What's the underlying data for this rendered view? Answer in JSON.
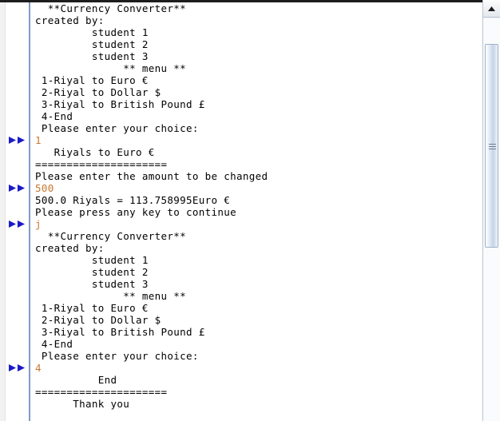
{
  "window": {
    "kind": "ide-console-output",
    "title": "Output"
  },
  "colors": {
    "output_text": "#000000",
    "input_text": "#c8762e",
    "gutter_rule": "#7e9bc4",
    "marker": "#1a1ac8",
    "scrollbar_thumb": "#c5d3e6",
    "background": "#ffffff"
  },
  "console": {
    "gutter": {
      "marker_icon": "double-right-triangle-icon",
      "marker_title": "user input line"
    },
    "lines": [
      {
        "id": 1,
        "text": "  **Currency Converter**",
        "kind": "output"
      },
      {
        "id": 2,
        "text": "created by:",
        "kind": "output"
      },
      {
        "id": 3,
        "text": "         student 1",
        "kind": "output"
      },
      {
        "id": 4,
        "text": "         student 2",
        "kind": "output"
      },
      {
        "id": 5,
        "text": "         student 3",
        "kind": "output"
      },
      {
        "id": 6,
        "text": "              ** menu **",
        "kind": "output"
      },
      {
        "id": 7,
        "text": " 1-Riyal to Euro €",
        "kind": "output"
      },
      {
        "id": 8,
        "text": " 2-Riyal to Dollar $",
        "kind": "output"
      },
      {
        "id": 9,
        "text": " 3-Riyal to British Pound £",
        "kind": "output"
      },
      {
        "id": 10,
        "text": " 4-End",
        "kind": "output"
      },
      {
        "id": 11,
        "text": " Please enter your choice:",
        "kind": "output"
      },
      {
        "id": 12,
        "text": "1",
        "kind": "input"
      },
      {
        "id": 13,
        "text": "   Riyals to Euro €",
        "kind": "output"
      },
      {
        "id": 14,
        "text": "=====================",
        "kind": "output"
      },
      {
        "id": 15,
        "text": "Please enter the amount to be changed",
        "kind": "output"
      },
      {
        "id": 16,
        "text": "500",
        "kind": "input"
      },
      {
        "id": 17,
        "text": "500.0 Riyals = 113.758995Euro €",
        "kind": "output"
      },
      {
        "id": 18,
        "text": "Please press any key to continue",
        "kind": "output"
      },
      {
        "id": 19,
        "text": "j",
        "kind": "input"
      },
      {
        "id": 20,
        "text": "  **Currency Converter**",
        "kind": "output"
      },
      {
        "id": 21,
        "text": "created by:",
        "kind": "output"
      },
      {
        "id": 22,
        "text": "         student 1",
        "kind": "output"
      },
      {
        "id": 23,
        "text": "         student 2",
        "kind": "output"
      },
      {
        "id": 24,
        "text": "         student 3",
        "kind": "output"
      },
      {
        "id": 25,
        "text": "              ** menu **",
        "kind": "output"
      },
      {
        "id": 26,
        "text": " 1-Riyal to Euro €",
        "kind": "output"
      },
      {
        "id": 27,
        "text": " 2-Riyal to Dollar $",
        "kind": "output"
      },
      {
        "id": 28,
        "text": " 3-Riyal to British Pound £",
        "kind": "output"
      },
      {
        "id": 29,
        "text": " 4-End",
        "kind": "output"
      },
      {
        "id": 30,
        "text": " Please enter your choice:",
        "kind": "output"
      },
      {
        "id": 31,
        "text": "4",
        "kind": "input"
      },
      {
        "id": 32,
        "text": "          End",
        "kind": "output"
      },
      {
        "id": 33,
        "text": "=====================",
        "kind": "output"
      },
      {
        "id": 34,
        "text": "      Thank you",
        "kind": "output"
      }
    ]
  },
  "scrollbar": {
    "orientation": "vertical",
    "up_button_icon": "caret-up-icon",
    "thumb_grip_icon": "grip-lines-icon"
  }
}
